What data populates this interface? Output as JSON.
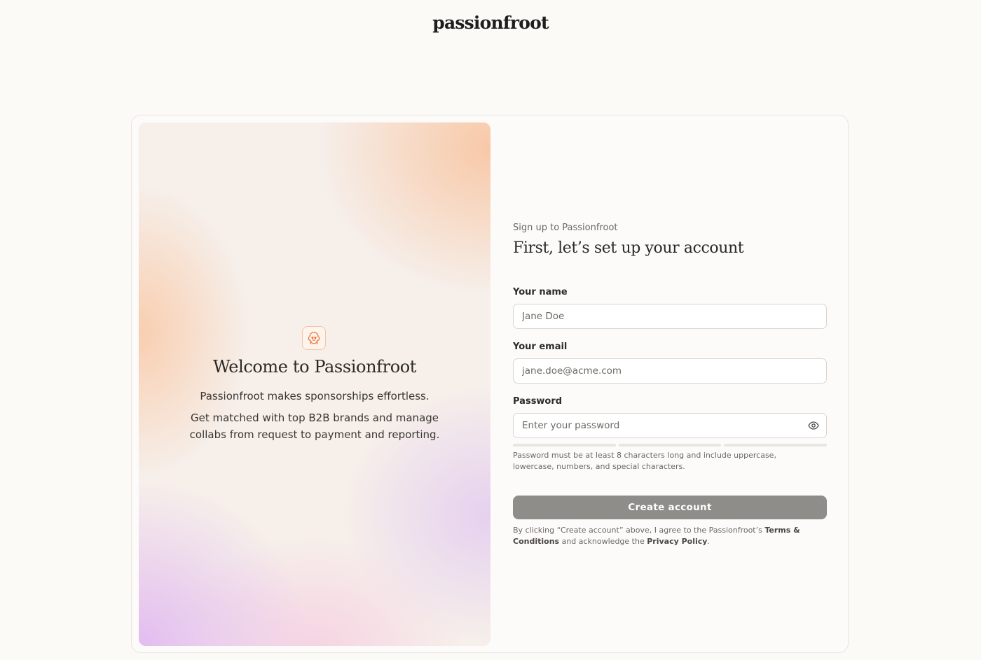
{
  "header": {
    "logo_text": "passionfroot"
  },
  "hero": {
    "icon": "passionfruit-mascot-icon",
    "title": "Welcome to Passionfroot",
    "line1": "Passionfroot makes sponsorships effortless.",
    "line2": "Get matched with top B2B brands and manage collabs from request to payment and reporting."
  },
  "form": {
    "eyebrow": "Sign up to Passionfroot",
    "title": "First, let’s set up your account",
    "name": {
      "label": "Your name",
      "placeholder": "Jane Doe",
      "value": ""
    },
    "email": {
      "label": "Your email",
      "placeholder": "jane.doe@acme.com",
      "value": ""
    },
    "password": {
      "label": "Password",
      "placeholder": "Enter your password",
      "value": "",
      "toggle_icon": "eye-icon",
      "strength_segments_filled": 0,
      "strength_segments_total": 3
    },
    "hint": "Password must be at least 8 characters long and include uppercase, lowercase, numbers, and special characters.",
    "submit_label": "Create account",
    "legal": {
      "prefix": "By clicking “Create account” above, I agree to the Passionfroot’s ",
      "terms_link": "Terms & Conditions",
      "middle": " and acknowledge the ",
      "privacy_link": "Privacy Policy",
      "suffix": "."
    }
  },
  "colors": {
    "page_bg": "#fbfaf7",
    "button_disabled": "#8e8d89",
    "accent_orange": "#e8743b"
  }
}
